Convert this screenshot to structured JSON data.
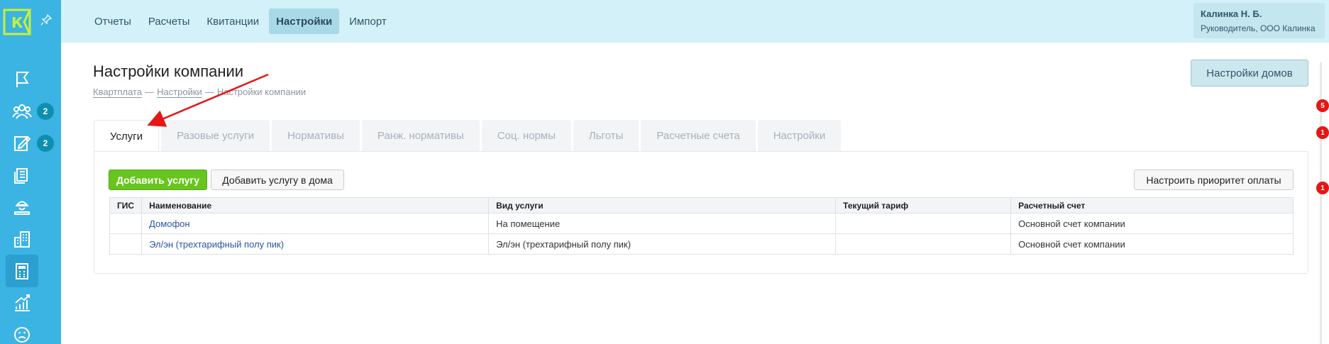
{
  "topbar": {
    "menu": [
      {
        "label": "Отчеты",
        "active": false
      },
      {
        "label": "Расчеты",
        "active": false
      },
      {
        "label": "Квитанции",
        "active": false
      },
      {
        "label": "Настройки",
        "active": true
      },
      {
        "label": "Импорт",
        "active": false
      }
    ],
    "user": {
      "name": "Калинка Н. Б.",
      "role": "Руководитель, ООО Калинка"
    }
  },
  "sidebar": {
    "logo_letter": "К",
    "badges": [
      "2",
      "2"
    ]
  },
  "page": {
    "title": "Настройки компании",
    "breadcrumb": [
      "Квартплата",
      "Настройки",
      "Настройки компании"
    ],
    "houses_button": "Настройки домов"
  },
  "tabs": [
    {
      "label": "Услуги",
      "active": true
    },
    {
      "label": "Разовые услуги",
      "active": false
    },
    {
      "label": "Нормативы",
      "active": false
    },
    {
      "label": "Ранж. нормативы",
      "active": false
    },
    {
      "label": "Соц. нормы",
      "active": false
    },
    {
      "label": "Льготы",
      "active": false
    },
    {
      "label": "Расчетные счета",
      "active": false
    },
    {
      "label": "Настройки",
      "active": false
    }
  ],
  "actions": {
    "add_service": "Добавить услугу",
    "add_to_houses": "Добавить услугу в дома",
    "payment_priority": "Настроить приоритет оплаты"
  },
  "table": {
    "columns": [
      "ГИС",
      "Наименование",
      "Вид услуги",
      "Текущий тариф",
      "Расчетный счет"
    ],
    "rows": [
      {
        "gis": "",
        "name": "Домофон",
        "type": "На помещение",
        "tariff": "",
        "account": "Основной счет компании"
      },
      {
        "gis": "",
        "name": "Эл/эн (трехтарифный полу пик)",
        "type": "Эл/эн (трехтарифный полу пик)",
        "tariff": "",
        "account": "Основной счет компании"
      }
    ]
  },
  "notifications": [
    "5",
    "1",
    "1"
  ],
  "colors": {
    "accent": "#3bb3e3",
    "topbar": "#d3f1f8",
    "add_button": "#67c51f",
    "link": "#2c54a5",
    "badge_red": "#e51616"
  }
}
